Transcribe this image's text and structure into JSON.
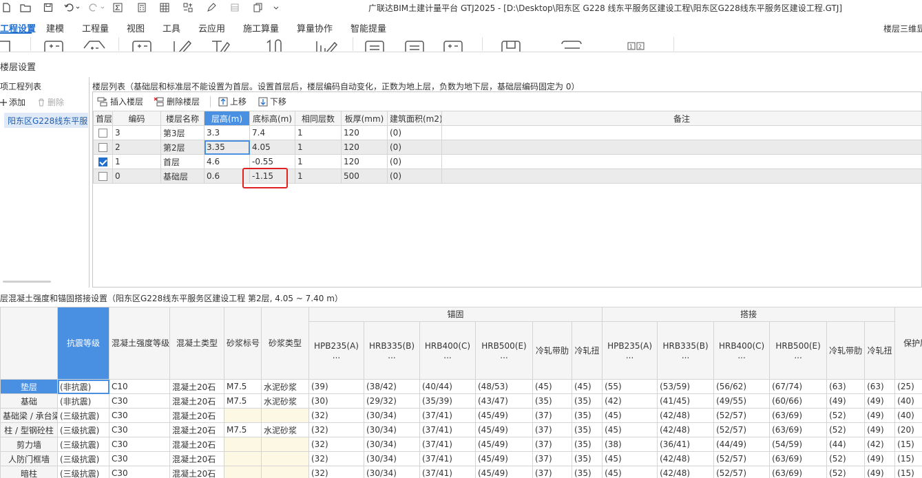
{
  "app": {
    "title": "广联达BIM土建计量平台 GTJ2025 - [D:\\Desktop\\阳东区 G228 线东平服务区建设工程\\阳东区G228线东平服务区建设工程.GTJ]"
  },
  "menu": {
    "items": [
      "工程设置",
      "建模",
      "工程量",
      "视图",
      "工具",
      "云应用",
      "施工算量",
      "算量协作",
      "智能提量"
    ],
    "active_index": 0,
    "right_label": "楼层三维显"
  },
  "section_title": "楼层设置",
  "left_panel": {
    "title": "项工程列表",
    "add_label": "添加",
    "delete_label": "删除",
    "project_item": "阳东区G228线东平服务区建设工程"
  },
  "floor_list": {
    "title": "楼层列表（基础层和标准层不能设置为首层。设置首层后，楼层编码自动变化，正数为地上层，负数为地下层，基础层编码固定为 0）",
    "toolbar": {
      "insert": "插入楼层",
      "delete": "删除楼层",
      "up": "上移",
      "down": "下移"
    },
    "columns": [
      "首层",
      "编码",
      "楼层名称",
      "层高(m)",
      "底标高(m)",
      "相同层数",
      "板厚(mm)",
      "建筑面积(m2)",
      "备注"
    ],
    "highlight_column": 3,
    "rows": [
      {
        "first": false,
        "code": "3",
        "name": "第3层",
        "height": "3.3",
        "bottom": "7.4",
        "same": "1",
        "slab": "120",
        "area": "(0)",
        "note": ""
      },
      {
        "first": false,
        "code": "2",
        "name": "第2层",
        "height": "3.35",
        "bottom": "4.05",
        "same": "1",
        "slab": "120",
        "area": "(0)",
        "note": ""
      },
      {
        "first": true,
        "code": "1",
        "name": "首层",
        "height": "4.6",
        "bottom": "-0.55",
        "same": "1",
        "slab": "120",
        "area": "(0)",
        "note": ""
      },
      {
        "first": false,
        "code": "0",
        "name": "基础层",
        "height": "0.6",
        "bottom": "-1.15",
        "same": "1",
        "slab": "500",
        "area": "(0)",
        "note": ""
      }
    ],
    "selected_row": 1,
    "accent": "#4a90e2",
    "annotation_color": "#e02020"
  },
  "concrete": {
    "title": "层混凝土强度和锚固搭接设置（阳东区G228线东平服务区建设工程  第2层, 4.05 ~ 7.40 m）",
    "group_anchor": "锚固",
    "group_lap": "搭接",
    "columns": [
      "抗震等级",
      "混凝土强度等级",
      "混凝土类型",
      "砂浆标号",
      "砂浆类型"
    ],
    "steel_columns": [
      [
        "HPB235(A)",
        "..."
      ],
      [
        "HRB335(B)",
        "..."
      ],
      [
        "HRB400(C)",
        "..."
      ],
      [
        "HRB500(E)",
        "..."
      ],
      [
        "冷轧带肋",
        ""
      ],
      [
        "冷轧扭",
        ""
      ]
    ],
    "cover_column": "保护层",
    "rows": [
      {
        "name": "垫层",
        "seismic": "(非抗震)",
        "grade": "C10",
        "type": "混凝土20石",
        "mortar": "M7.5",
        "mortar_type": "水泥砂浆",
        "anchor": [
          "(39)",
          "(38/42)",
          "(40/44)",
          "(48/53)",
          "(45)",
          "(45)"
        ],
        "lap": [
          "(55)",
          "(53/59)",
          "(56/62)",
          "(67/74)",
          "(63)",
          "(63)"
        ],
        "cover": "(25)"
      },
      {
        "name": "基础",
        "seismic": "(非抗震)",
        "grade": "C30",
        "type": "混凝土20石",
        "mortar": "M7.5",
        "mortar_type": "水泥砂浆",
        "anchor": [
          "(30)",
          "(29/32)",
          "(35/39)",
          "(43/47)",
          "(35)",
          "(35)"
        ],
        "lap": [
          "(42)",
          "(41/45)",
          "(49/55)",
          "(60/66)",
          "(49)",
          "(49)"
        ],
        "cover": "(40)"
      },
      {
        "name": "基础梁 / 承台梁",
        "seismic": "(三级抗震)",
        "grade": "C30",
        "type": "混凝土20石",
        "mortar": "",
        "mortar_type": "",
        "anchor": [
          "(32)",
          "(30/34)",
          "(37/41)",
          "(45/49)",
          "(37)",
          "(35)"
        ],
        "lap": [
          "(45)",
          "(42/48)",
          "(52/57)",
          "(63/69)",
          "(52)",
          "(49)"
        ],
        "cover": "(40)"
      },
      {
        "name": "柱 / 型钢砼柱",
        "seismic": "(三级抗震)",
        "grade": "C30",
        "type": "混凝土20石",
        "mortar": "M7.5",
        "mortar_type": "水泥砂浆",
        "anchor": [
          "(32)",
          "(30/34)",
          "(37/41)",
          "(45/49)",
          "(37)",
          "(35)"
        ],
        "lap": [
          "(45)",
          "(42/48)",
          "(52/57)",
          "(63/69)",
          "(52)",
          "(49)"
        ],
        "cover": "(20)"
      },
      {
        "name": "剪力墙",
        "seismic": "(三级抗震)",
        "grade": "C30",
        "type": "混凝土20石",
        "mortar": "",
        "mortar_type": "",
        "anchor": [
          "(32)",
          "(30/34)",
          "(37/41)",
          "(45/49)",
          "(37)",
          "(35)"
        ],
        "lap": [
          "(38)",
          "(36/41)",
          "(44/49)",
          "(54/59)",
          "(44)",
          "(42)"
        ],
        "cover": "(15)"
      },
      {
        "name": "人防门框墙",
        "seismic": "(三级抗震)",
        "grade": "C30",
        "type": "混凝土20石",
        "mortar": "",
        "mortar_type": "",
        "anchor": [
          "(32)",
          "(30/34)",
          "(37/41)",
          "(45/49)",
          "(37)",
          "(35)"
        ],
        "lap": [
          "(45)",
          "(42/48)",
          "(52/57)",
          "(63/69)",
          "(52)",
          "(49)"
        ],
        "cover": "(15)"
      },
      {
        "name": "暗柱",
        "seismic": "(三级抗震)",
        "grade": "C30",
        "type": "混凝土20石",
        "mortar": "",
        "mortar_type": "",
        "anchor": [
          "(32)",
          "(30/34)",
          "(37/41)",
          "(45/49)",
          "(37)",
          "(35)"
        ],
        "lap": [
          "(45)",
          "(42/48)",
          "(52/57)",
          "(63/69)",
          "(52)",
          "(49)"
        ],
        "cover": "(15)"
      }
    ]
  }
}
